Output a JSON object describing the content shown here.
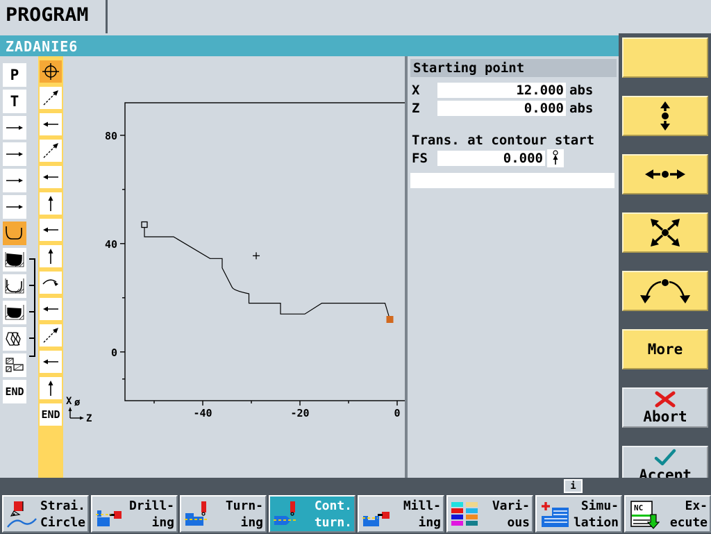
{
  "window": {
    "app_title": "PROGRAM",
    "program_name": "ZADANIE6"
  },
  "left_elements": [
    {
      "name": "program-head-icon",
      "label": "P",
      "type": "text",
      "selected": false
    },
    {
      "name": "tool-icon",
      "label": "T",
      "type": "text",
      "selected": false
    },
    {
      "name": "linear-move-1-icon",
      "label": "",
      "type": "arrow-right",
      "selected": false
    },
    {
      "name": "linear-move-2-icon",
      "label": "",
      "type": "arrow-right",
      "selected": false
    },
    {
      "name": "linear-move-3-icon",
      "label": "",
      "type": "arrow-right",
      "selected": false
    },
    {
      "name": "linear-move-4-icon",
      "label": "",
      "type": "arrow-right",
      "selected": false
    },
    {
      "name": "contour-icon",
      "label": "",
      "type": "contour",
      "selected": true
    },
    {
      "name": "stock-removal-icon",
      "label": "",
      "type": "cut1",
      "selected": false
    },
    {
      "name": "residual-material-icon",
      "label": "",
      "type": "cut2",
      "selected": false
    },
    {
      "name": "finishing-icon",
      "label": "",
      "type": "cut3",
      "selected": false
    },
    {
      "name": "thread-icon",
      "label": "",
      "type": "thread",
      "selected": false
    },
    {
      "name": "groove-icon",
      "label": "",
      "type": "groove",
      "selected": false
    },
    {
      "name": "end-of-program-icon",
      "label": "END",
      "type": "text",
      "selected": false
    }
  ],
  "contour_elements": [
    {
      "name": "start-point-icon",
      "type": "crosshair",
      "selected": true
    },
    {
      "name": "line-diagonal-1-icon",
      "type": "diag",
      "selected": false
    },
    {
      "name": "line-horizontal-1-icon",
      "type": "left",
      "selected": false
    },
    {
      "name": "line-diagonal-2-icon",
      "type": "diag",
      "selected": false
    },
    {
      "name": "line-horizontal-2-icon",
      "type": "left",
      "selected": false
    },
    {
      "name": "line-vertical-1-icon",
      "type": "up",
      "selected": false
    },
    {
      "name": "line-horizontal-3-icon",
      "type": "left",
      "selected": false
    },
    {
      "name": "line-vertical-2-icon",
      "type": "up",
      "selected": false
    },
    {
      "name": "arc-1-icon",
      "type": "arc",
      "selected": false
    },
    {
      "name": "line-horizontal-4-icon",
      "type": "left",
      "selected": false
    },
    {
      "name": "line-diagonal-3-icon",
      "type": "diag",
      "selected": false
    },
    {
      "name": "line-horizontal-5-icon",
      "type": "left",
      "selected": false
    },
    {
      "name": "line-vertical-3-icon",
      "type": "up",
      "selected": false
    },
    {
      "name": "contour-end-icon",
      "type": "text",
      "label": "END",
      "selected": false
    }
  ],
  "axis_indicator": {
    "x_label": "X",
    "x_symbol": "ø",
    "z_label": "Z"
  },
  "chart_data": {
    "type": "line",
    "title": "",
    "xlabel": "Z",
    "ylabel": "X",
    "xlim": [
      -56,
      2
    ],
    "ylim": [
      -18,
      92
    ],
    "xticks": [
      -40,
      -20,
      0
    ],
    "xticklabels": [
      "-40",
      "-20",
      "0"
    ],
    "yticks": [
      80,
      40,
      0
    ],
    "yticklabels": [
      "80",
      "40",
      "0"
    ],
    "grid": false,
    "legend": false,
    "start_marker": {
      "z": -52.0,
      "x": 47.0,
      "style": "hollow-square"
    },
    "end_marker": {
      "z": -1.5,
      "x": 12.0,
      "style": "filled-orange-square"
    },
    "cursor_marker": {
      "z": -29.0,
      "x": 35.5,
      "style": "small-plus"
    },
    "series": [
      {
        "name": "contour",
        "points": [
          {
            "z": -52.0,
            "x": 47.0
          },
          {
            "z": -52.0,
            "x": 42.5
          },
          {
            "z": -46.0,
            "x": 42.5
          },
          {
            "z": -38.5,
            "x": 34.5
          },
          {
            "z": -36.0,
            "x": 34.5
          },
          {
            "z": -36.0,
            "x": 31.0
          },
          {
            "z": -34.0,
            "x": 24.0
          },
          {
            "z": -30.5,
            "x": 21.5
          },
          {
            "z": -30.5,
            "x": 18.0
          },
          {
            "z": -24.0,
            "x": 18.0
          },
          {
            "z": -24.0,
            "x": 14.0
          },
          {
            "z": -19.0,
            "x": 14.0
          },
          {
            "z": -15.5,
            "x": 18.0
          },
          {
            "z": -2.5,
            "x": 18.0
          },
          {
            "z": -1.5,
            "x": 12.0
          }
        ]
      }
    ]
  },
  "form": {
    "header": "Starting point",
    "fields": [
      {
        "label": "X",
        "value": "12.000",
        "unit": "abs"
      },
      {
        "label": "Z",
        "value": "0.000",
        "unit": "abs"
      }
    ],
    "section": "Trans. at contour start",
    "transition": {
      "label": "FS",
      "value": "0.000",
      "icon": "chamfer-icon"
    }
  },
  "vertical_softkeys": [
    {
      "name": "softkey-blank",
      "label": "",
      "icon": "none",
      "style": "yellow"
    },
    {
      "name": "softkey-zoom-vertical",
      "label": "",
      "icon": "arrows-vertical-icon",
      "style": "yellow"
    },
    {
      "name": "softkey-zoom-horizontal",
      "label": "",
      "icon": "arrows-horizontal-icon",
      "style": "yellow"
    },
    {
      "name": "softkey-zoom-all",
      "label": "",
      "icon": "arrows-diagonal-icon",
      "style": "yellow"
    },
    {
      "name": "softkey-rotate",
      "label": "",
      "icon": "arc-arrows-icon",
      "style": "yellow"
    },
    {
      "name": "softkey-more",
      "label": "More",
      "icon": "none",
      "style": "yellow"
    },
    {
      "name": "softkey-abort",
      "label": "Abort",
      "icon": "red-cross-icon",
      "style": "grey"
    },
    {
      "name": "softkey-accept",
      "label": "Accept",
      "icon": "teal-check-icon",
      "style": "grey"
    }
  ],
  "info_button": {
    "label": "i"
  },
  "horizontal_softkeys": [
    {
      "name": "softkey-straight-circle",
      "label": "Strai.\nCircle",
      "icon": "tool-curve-icon",
      "selected": false
    },
    {
      "name": "softkey-drilling",
      "label": "Drill-\ning",
      "icon": "drill-icon",
      "selected": false
    },
    {
      "name": "softkey-turning",
      "label": "Turn-\ning",
      "icon": "turning-icon",
      "selected": false
    },
    {
      "name": "softkey-contour-turning",
      "label": "Cont.\nturn.",
      "icon": "contour-turn-icon",
      "selected": true
    },
    {
      "name": "softkey-milling",
      "label": "Mill-\ning",
      "icon": "milling-icon",
      "selected": false
    },
    {
      "name": "softkey-various",
      "label": "Vari-\nous",
      "icon": "color-grid-icon",
      "selected": false
    },
    {
      "name": "softkey-simulation",
      "label": "Simu-\nlation",
      "icon": "simulation-icon",
      "selected": false
    },
    {
      "name": "softkey-execute",
      "label": "Ex-\necute",
      "icon": "nc-execute-icon",
      "selected": false
    }
  ],
  "colors": {
    "title_bar": "#4cafc4",
    "panel_bg": "#d2d9e0",
    "softkey_bar": "#4d565f",
    "softkey_yellow": "#fbe073",
    "softkey_grey": "#ccd4db",
    "selected_highlight": "#f5a836",
    "contour_column": "#ffd75e",
    "accent_selected_key": "#2aa8bd",
    "end_marker": "#d2691e"
  }
}
